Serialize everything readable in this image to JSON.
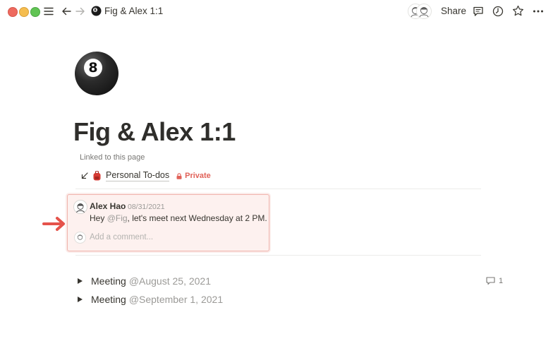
{
  "window": {
    "title": "Fig & Alex 1:1",
    "share_label": "Share"
  },
  "page": {
    "title": "Fig & Alex 1:1",
    "icon": "8-ball-icon",
    "icon_text": "8"
  },
  "linked": {
    "label": "Linked to this page",
    "page_name": "Personal To-dos",
    "page_emoji": "backpack-icon",
    "visibility": "Private"
  },
  "comment": {
    "author": "Alex Hao",
    "date": "08/31/2021",
    "text_before": "Hey ",
    "mention": "@Fig",
    "text_after": ", let's meet next Wednesday at 2 PM.",
    "reply_placeholder": "Add a comment..."
  },
  "meetings": [
    {
      "label": "Meeting",
      "date": "@August 25, 2021",
      "comment_count": "1"
    },
    {
      "label": "Meeting",
      "date": "@September 1, 2021"
    }
  ],
  "colors": {
    "accent_red": "#e16259",
    "comment_bg": "#fdf1ef",
    "comment_border": "#f0b4ad",
    "arrow": "#e5534b"
  }
}
